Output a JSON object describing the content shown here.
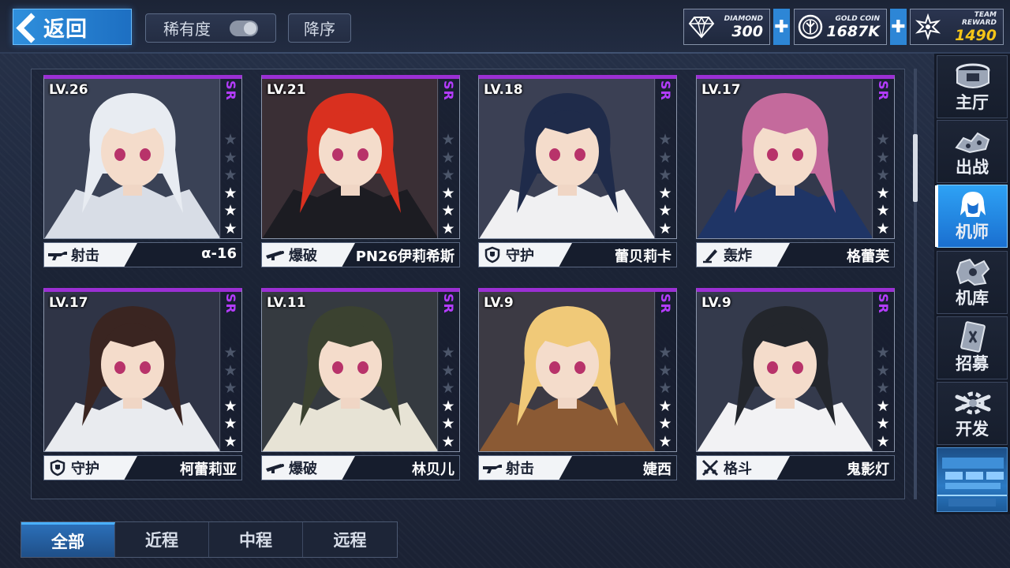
{
  "header": {
    "back_label": "返回",
    "rarity_label": "稀有度",
    "sort_label": "降序",
    "resources": [
      {
        "caption": "DIAMOND",
        "value": "300",
        "icon": "diamond-icon",
        "color": "#ffffff"
      },
      {
        "caption": "GOLD COIN",
        "value": "1687K",
        "icon": "gold-coin-icon",
        "color": "#ffffff"
      },
      {
        "caption": "TEAM REWARD",
        "value": "1490",
        "icon": "team-reward-icon",
        "color": "#f5c518"
      }
    ],
    "plus_icon": "plus-icon"
  },
  "pilots": [
    {
      "level": "LV.26",
      "rarity": "SR",
      "stars": 3,
      "max_stars": 6,
      "role": "射击",
      "role_icon": "rifle-icon",
      "name": "α-16",
      "hair": "#e8ecf2",
      "accent": "#d8dde6",
      "bg": "#3a4256"
    },
    {
      "level": "LV.21",
      "rarity": "SR",
      "stars": 3,
      "max_stars": 6,
      "role": "爆破",
      "role_icon": "bazooka-icon",
      "name": "PN26伊莉希斯",
      "hair": "#d9301f",
      "accent": "#1c1c22",
      "bg": "#3a2f35"
    },
    {
      "level": "LV.18",
      "rarity": "SR",
      "stars": 3,
      "max_stars": 6,
      "role": "守护",
      "role_icon": "shield-icon",
      "name": "蕾贝莉卡",
      "hair": "#1f2b4a",
      "accent": "#f0f0f2",
      "bg": "#3b4054"
    },
    {
      "level": "LV.17",
      "rarity": "SR",
      "stars": 3,
      "max_stars": 6,
      "role": "轰炸",
      "role_icon": "mortar-icon",
      "name": "格蕾芙",
      "hair": "#c46a9c",
      "accent": "#1f3566",
      "bg": "#33394d"
    },
    {
      "level": "LV.17",
      "rarity": "SR",
      "stars": 3,
      "max_stars": 6,
      "role": "守护",
      "role_icon": "shield-icon",
      "name": "柯蕾莉亚",
      "hair": "#3a2521",
      "accent": "#e9ebef",
      "bg": "#2f3446"
    },
    {
      "level": "LV.11",
      "rarity": "SR",
      "stars": 3,
      "max_stars": 6,
      "role": "爆破",
      "role_icon": "bazooka-icon",
      "name": "林贝儿",
      "hair": "#3b4230",
      "accent": "#e7e3d5",
      "bg": "#353a40"
    },
    {
      "level": "LV.9",
      "rarity": "SR",
      "stars": 3,
      "max_stars": 6,
      "role": "射击",
      "role_icon": "rifle-icon",
      "name": "婕西",
      "hair": "#f0c978",
      "accent": "#8b5a34",
      "bg": "#3c3a44"
    },
    {
      "level": "LV.9",
      "rarity": "SR",
      "stars": 3,
      "max_stars": 6,
      "role": "格斗",
      "role_icon": "crossed-swords-icon",
      "name": "鬼影灯",
      "hair": "#23262c",
      "accent": "#f2f2f4",
      "bg": "#343a4c"
    }
  ],
  "nav": [
    {
      "label": "主厅",
      "icon": "lobby-icon",
      "active": false
    },
    {
      "label": "出战",
      "icon": "sortie-icon",
      "active": false
    },
    {
      "label": "机师",
      "icon": "pilot-icon",
      "active": true
    },
    {
      "label": "机库",
      "icon": "hangar-icon",
      "active": false
    },
    {
      "label": "招募",
      "icon": "recruit-icon",
      "active": false
    },
    {
      "label": "开发",
      "icon": "develop-icon",
      "active": false
    }
  ],
  "tabs": [
    {
      "label": "全部",
      "active": true
    },
    {
      "label": "近程",
      "active": false
    },
    {
      "label": "中程",
      "active": false
    },
    {
      "label": "远程",
      "active": false
    }
  ],
  "colors": {
    "rarity_sr": "#b43cff",
    "card_top": "#9b2fd4",
    "accent_blue": "#2e86d6"
  }
}
